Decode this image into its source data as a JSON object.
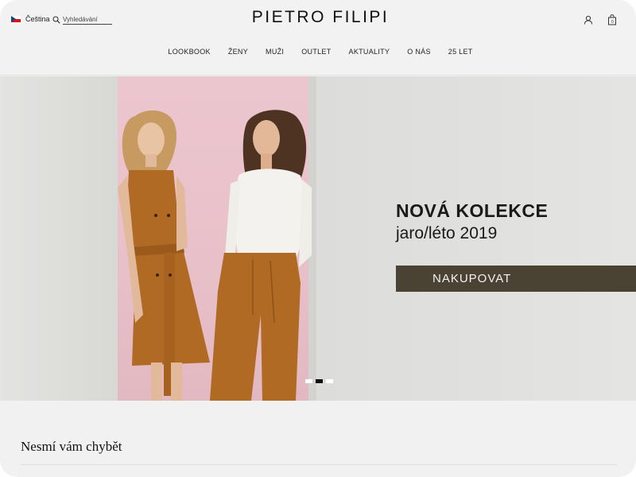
{
  "header": {
    "language": "Čeština",
    "search_placeholder": "Vyhledávání",
    "brand": "PIETRO FILIPI",
    "cart_count": "0",
    "icons": [
      "flag-cz-icon",
      "search-icon",
      "user-icon",
      "shopping-bag-icon"
    ]
  },
  "nav": {
    "items": [
      {
        "label": "LOOKBOOK"
      },
      {
        "label": "ŽENY"
      },
      {
        "label": "MUŽI"
      },
      {
        "label": "OUTLET"
      },
      {
        "label": "AKTUALITY"
      },
      {
        "label": "O NÁS"
      },
      {
        "label": "25 LET"
      }
    ]
  },
  "hero": {
    "title": "NOVÁ KOLEKCE",
    "subtitle": "jaro/léto 2019",
    "cta_label": "NAKUPOVAT",
    "slides_total": 3,
    "active_slide": 2,
    "colors": {
      "cta_bg": "#4a4333",
      "pink_wall": "#ecc6cf",
      "garment": "#b06a24"
    }
  },
  "section": {
    "title": "Nesmí vám chybět"
  }
}
